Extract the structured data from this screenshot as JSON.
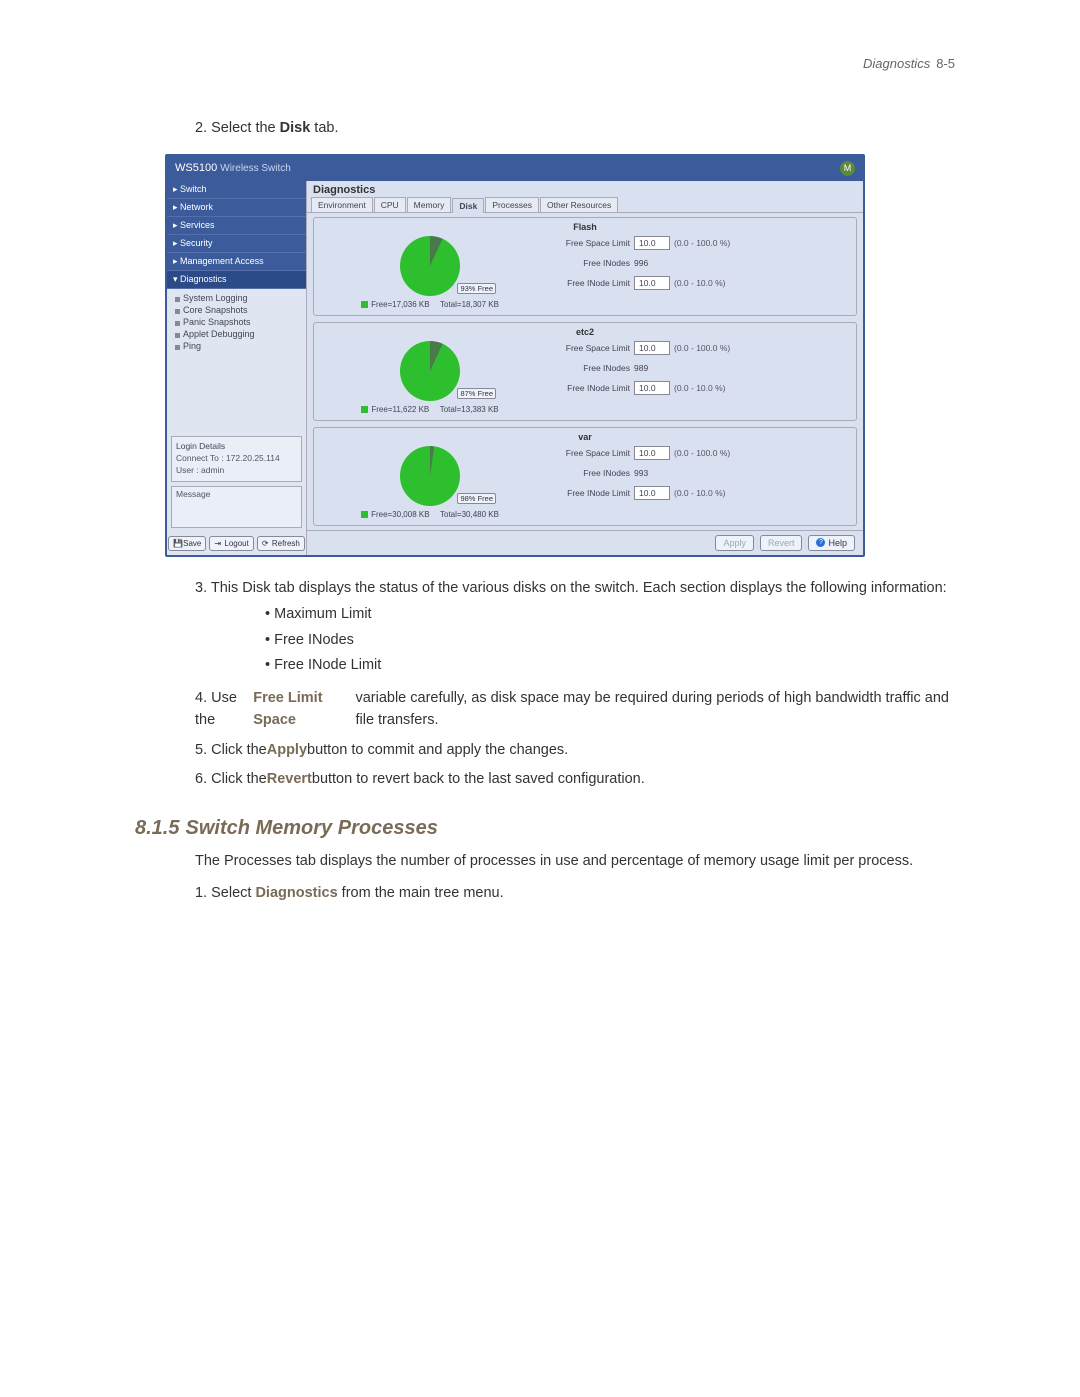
{
  "header": {
    "section": "Diagnostics",
    "page": "8-5"
  },
  "step2": {
    "prefix": "2. Select the ",
    "bold": "Disk",
    "suffix": " tab."
  },
  "app": {
    "title_main": "WS5100",
    "title_sub": "Wireless Switch",
    "main_title": "Diagnostics",
    "nav": {
      "switch": "Switch",
      "network": "Network",
      "services": "Services",
      "security": "Security",
      "mgmt": "Management Access",
      "diag": "Diagnostics"
    },
    "subnav": {
      "syslog": "System Logging",
      "core": "Core Snapshots",
      "panic": "Panic Snapshots",
      "applet": "Applet Debugging",
      "ping": "Ping"
    },
    "tabs": {
      "env": "Environment",
      "cpu": "CPU",
      "mem": "Memory",
      "disk": "Disk",
      "proc": "Processes",
      "other": "Other Resources"
    },
    "login": {
      "title": "Login Details",
      "connect_label": "Connect To :",
      "connect_val": "172.20.25.114",
      "user_label": "User :",
      "user_val": "admin"
    },
    "message_title": "Message",
    "sidebar_buttons": {
      "save": "Save",
      "logout": "Logout",
      "refresh": "Refresh"
    },
    "footer": {
      "apply": "Apply",
      "revert": "Revert",
      "help": "Help"
    },
    "field_labels": {
      "free_space": "Free Space Limit",
      "free_inodes": "Free INodes",
      "free_inode_limit": "Free INode Limit"
    }
  },
  "chart_data": [
    {
      "type": "pie",
      "title": "Flash",
      "badge": "93% Free",
      "legend_free": "Free=17,036 KB",
      "legend_total": "Total=18,307 KB",
      "series": [
        {
          "name": "Free",
          "value": 17036
        },
        {
          "name": "Used",
          "value": 1271
        }
      ],
      "fields": {
        "free_space_limit": {
          "value": "10.0",
          "range": "(0.0 - 100.0 %)"
        },
        "free_inodes": {
          "value": "996"
        },
        "free_inode_limit": {
          "value": "10.0",
          "range": "(0.0 - 10.0 %)"
        }
      }
    },
    {
      "type": "pie",
      "title": "etc2",
      "badge": "87% Free",
      "legend_free": "Free=11,622 KB",
      "legend_total": "Total=13,383 KB",
      "series": [
        {
          "name": "Free",
          "value": 11622
        },
        {
          "name": "Used",
          "value": 1761
        }
      ],
      "fields": {
        "free_space_limit": {
          "value": "10.0",
          "range": "(0.0 - 100.0 %)"
        },
        "free_inodes": {
          "value": "989"
        },
        "free_inode_limit": {
          "value": "10.0",
          "range": "(0.0 - 10.0 %)"
        }
      }
    },
    {
      "type": "pie",
      "title": "var",
      "badge": "98% Free",
      "legend_free": "Free=30,008 KB",
      "legend_total": "Total=30,480 KB",
      "series": [
        {
          "name": "Free",
          "value": 30008
        },
        {
          "name": "Used",
          "value": 472
        }
      ],
      "fields": {
        "free_space_limit": {
          "value": "10.0",
          "range": "(0.0 - 100.0 %)"
        },
        "free_inodes": {
          "value": "993"
        },
        "free_inode_limit": {
          "value": "10.0",
          "range": "(0.0 - 10.0 %)"
        }
      }
    }
  ],
  "steps": {
    "s3_a": "3. This Disk tab displays the status of the various disks on the switch. Each section displays the following information:",
    "b1": "Maximum Limit",
    "b2": "Free INodes",
    "b3": "Free INode Limit",
    "s4_a": "4. Use the ",
    "s4_bold": "Free Limit Space",
    "s4_b": " variable carefully, as disk space may be required during periods of high bandwidth traffic and file transfers.",
    "s5_a": "5. Click the ",
    "s5_bold": "Apply",
    "s5_b": " button to commit and apply the changes.",
    "s6_a": "6. Click the ",
    "s6_bold": "Revert",
    "s6_b": " button to revert back to the last saved configuration."
  },
  "section": {
    "num": "8.1.5",
    "title": "Switch Memory Processes",
    "desc": "The Processes tab displays the number of processes in use and percentage of memory usage limit per process.",
    "step1_a": "1. Select ",
    "step1_bold": "Diagnostics",
    "step1_b": " from the main tree menu."
  }
}
